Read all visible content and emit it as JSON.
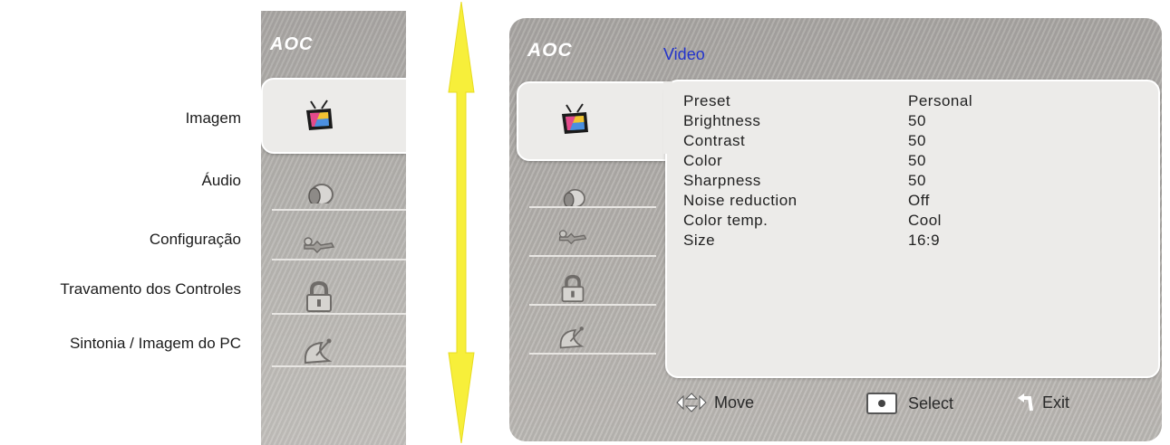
{
  "captions": [
    "Imagem",
    "Áudio",
    "Configuração",
    "Travamento dos Controles",
    "Sintonia / Imagem do PC"
  ],
  "brand": "AOC",
  "osd": {
    "title": "Video",
    "settings": [
      {
        "label": "Preset",
        "value": "Personal"
      },
      {
        "label": "Brightness",
        "value": "50"
      },
      {
        "label": "Contrast",
        "value": "50"
      },
      {
        "label": "Color",
        "value": "50"
      },
      {
        "label": "Sharpness",
        "value": "50"
      },
      {
        "label": "Noise reduction",
        "value": "Off"
      },
      {
        "label": "Color temp.",
        "value": "Cool"
      },
      {
        "label": "Size",
        "value": "16:9"
      }
    ],
    "footer": {
      "move": "Move",
      "select": "Select",
      "exit": "Exit"
    }
  },
  "menu_icons": [
    "tv-icon",
    "speaker-icon",
    "tools-icon",
    "lock-icon",
    "satellite-dish-icon"
  ],
  "colors": {
    "title": "#2233cc",
    "arrow": "#f7ef3a"
  }
}
